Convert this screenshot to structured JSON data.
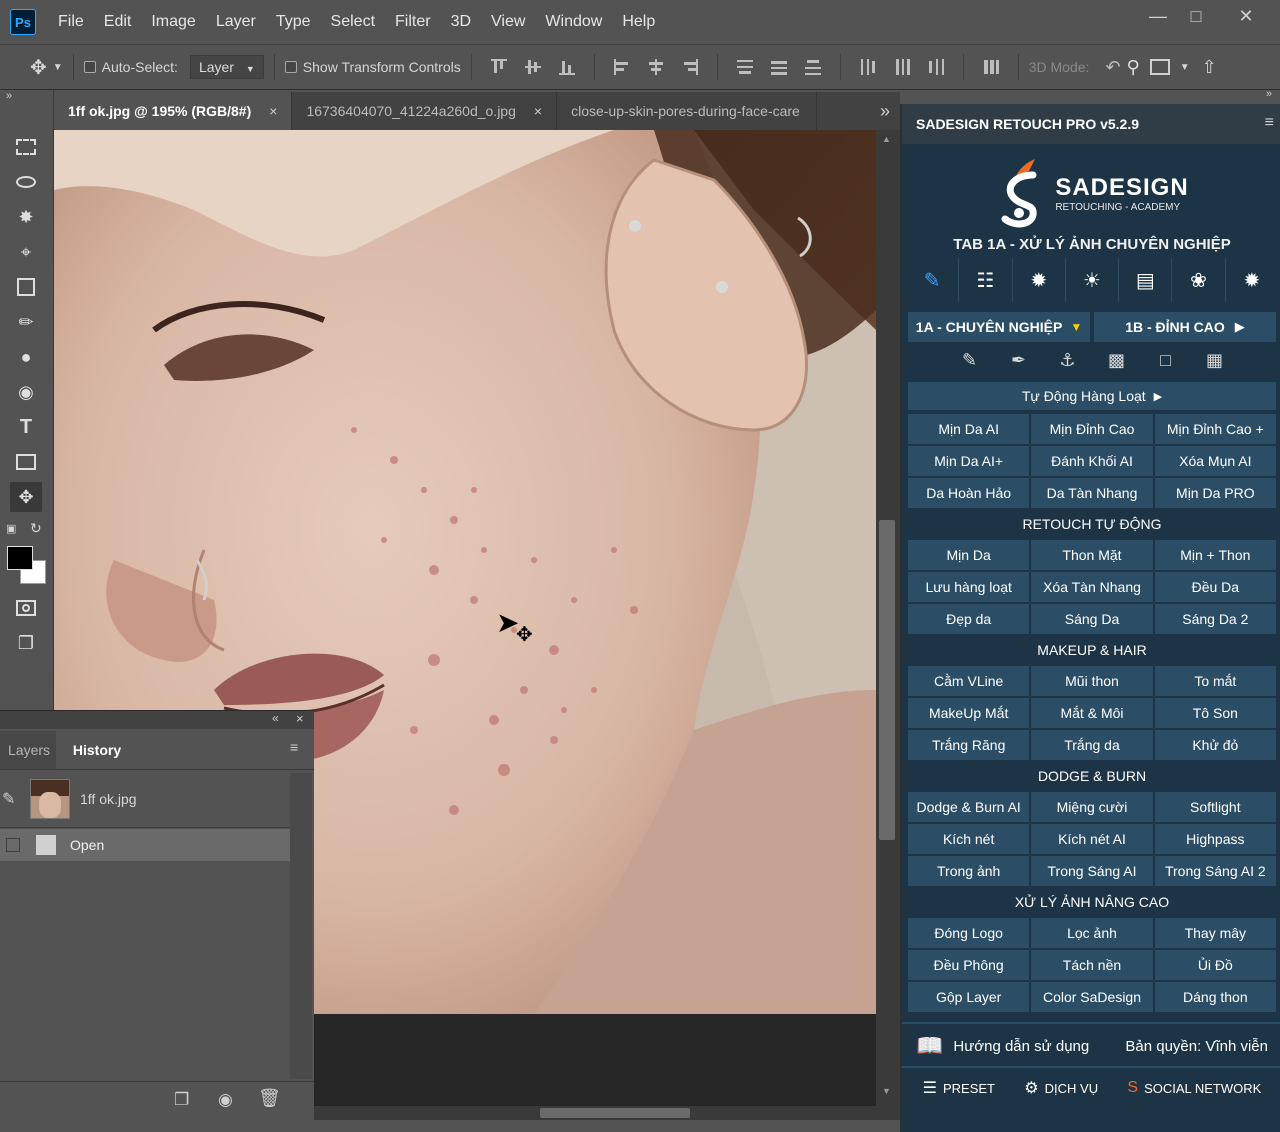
{
  "app": {
    "logo_text": "Ps"
  },
  "menu": [
    "File",
    "Edit",
    "Image",
    "Layer",
    "Type",
    "Select",
    "Filter",
    "3D",
    "View",
    "Window",
    "Help"
  ],
  "options_bar": {
    "auto_select_label": "Auto-Select:",
    "auto_select_value": "Layer",
    "show_transform_label": "Show Transform Controls",
    "mode_3d_label": "3D Mode:"
  },
  "tabs": [
    {
      "label": "1ff ok.jpg @ 195% (RGB/8#)",
      "close": "×",
      "active": true
    },
    {
      "label": "16736404070_41224a260d_o.jpg",
      "close": "×",
      "active": false
    },
    {
      "label": "close-up-skin-pores-during-face-care",
      "close": "",
      "active": false
    }
  ],
  "tabs_overflow": "»",
  "panel": {
    "collapse": "«",
    "close": "×",
    "tab_layers": "Layers",
    "tab_history": "History",
    "menu_icon": "≡",
    "history_snapshot": "1ff ok.jpg",
    "history_state": "Open"
  },
  "plugin": {
    "title": "SADESIGN RETOUCH PRO v5.2.9",
    "menu_icon": "≡",
    "brand_name": "SADESIGN",
    "brand_sub": "RETOUCHING - ACADEMY",
    "tab_heading": "TAB 1A - XỬ LÝ ẢNH CHUYÊN NGHIỆP",
    "mode_1a": "1A - CHUYÊN NGHIỆP",
    "mode_1b": "1B - ĐỈNH CAO",
    "auto_batch": "Tự Động Hàng Loạt",
    "rows_1": [
      [
        "Mịn Da AI",
        "Mịn Đỉnh Cao",
        "Mịn Đỉnh Cao +"
      ],
      [
        "Mịn Da AI+",
        "Đánh Khối AI",
        "Xóa Mụn AI"
      ],
      [
        "Da Hoàn Hảo",
        "Da Tàn Nhang",
        "Mịn Da PRO"
      ]
    ],
    "section_retouch": "RETOUCH TỰ ĐỘNG",
    "rows_2": [
      [
        "Mịn Da",
        "Thon Mặt",
        "Mịn + Thon"
      ],
      [
        "Lưu hàng loạt",
        "Xóa Tàn Nhang",
        "Đều Da"
      ],
      [
        "Đẹp da",
        "Sáng Da",
        "Sáng Da 2"
      ]
    ],
    "section_makeup": "MAKEUP & HAIR",
    "rows_3": [
      [
        "Cằm VLine",
        "Mũi thon",
        "To mắt"
      ],
      [
        "MakeUp Mắt",
        "Mắt & Môi",
        "Tô Son"
      ],
      [
        "Trắng Răng",
        "Trắng da",
        "Khử đỏ"
      ]
    ],
    "section_dodge": "DODGE & BURN",
    "rows_4": [
      [
        "Dodge & Burn AI",
        "Miệng cười",
        "Softlight"
      ],
      [
        "Kích nét",
        "Kích nét AI",
        "Highpass"
      ],
      [
        "Trong ảnh",
        "Trong Sáng AI",
        "Trong Sáng AI 2"
      ]
    ],
    "section_advanced": "XỬ LÝ ẢNH NÂNG CAO",
    "rows_5": [
      [
        "Đóng Logo",
        "Lọc ảnh",
        "Thay mây"
      ],
      [
        "Đều Phông",
        "Tách nền",
        "Ủi Đồ"
      ],
      [
        "Gộp Layer",
        "Color SaDesign",
        "Dáng thon"
      ]
    ],
    "guide": "Hướng dẫn sử dụng",
    "license": "Bản quyền: Vĩnh viễn",
    "footer": [
      "PRESET",
      "DỊCH VỤ",
      "SOCIAL NETWORK"
    ]
  }
}
